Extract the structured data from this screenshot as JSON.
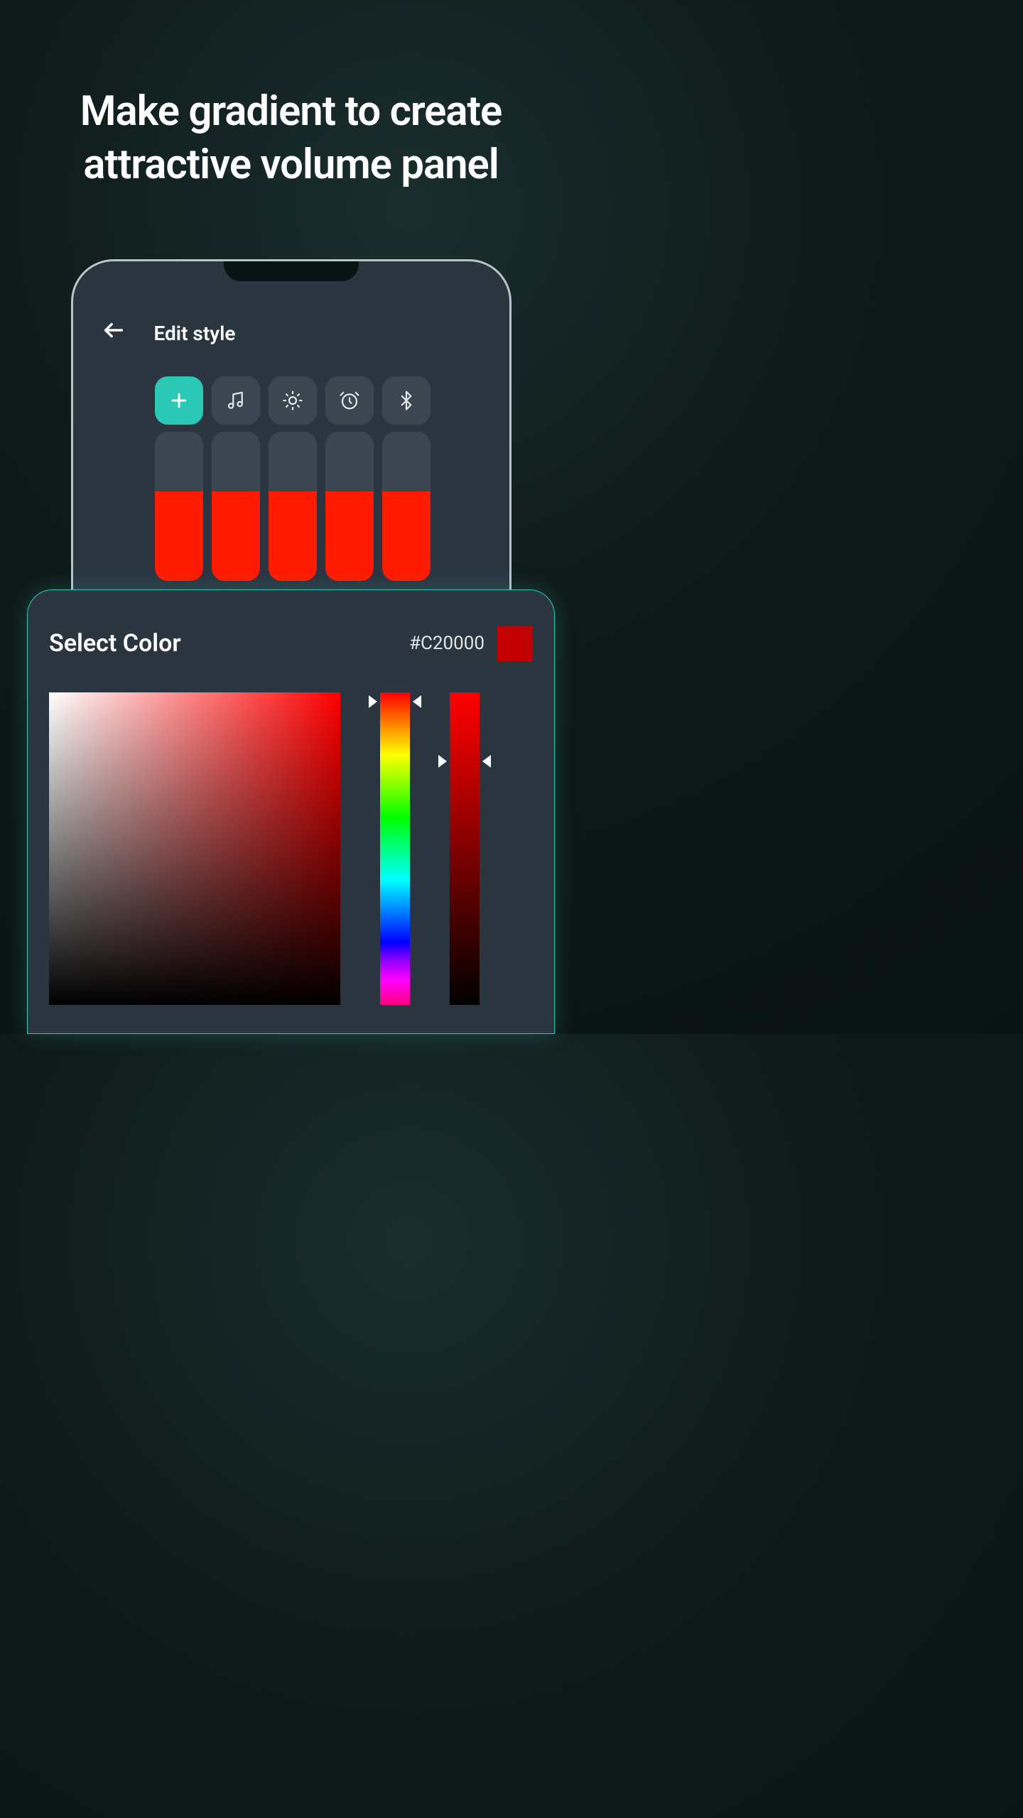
{
  "headline": "Make gradient to create attractive volume panel",
  "app": {
    "title": "Edit style",
    "actions": [
      {
        "name": "plus",
        "active": true
      },
      {
        "name": "music",
        "active": false
      },
      {
        "name": "brightness",
        "active": false
      },
      {
        "name": "alarm",
        "active": false
      },
      {
        "name": "bluetooth",
        "active": false
      }
    ],
    "sliders": [
      {
        "fill_percent": 60
      },
      {
        "fill_percent": 60
      },
      {
        "fill_percent": 60
      },
      {
        "fill_percent": 60
      },
      {
        "fill_percent": 60
      }
    ],
    "slider_fill_color": "#ff1a00"
  },
  "picker": {
    "title": "Select Color",
    "hex": "#C20000",
    "swatch_color": "#c20000",
    "hue_marker_percent": 3,
    "value_marker_percent": 22
  },
  "colors": {
    "accent": "#2bc9b5",
    "panel_bg": "#2a3540",
    "control_bg": "#3c4650"
  }
}
